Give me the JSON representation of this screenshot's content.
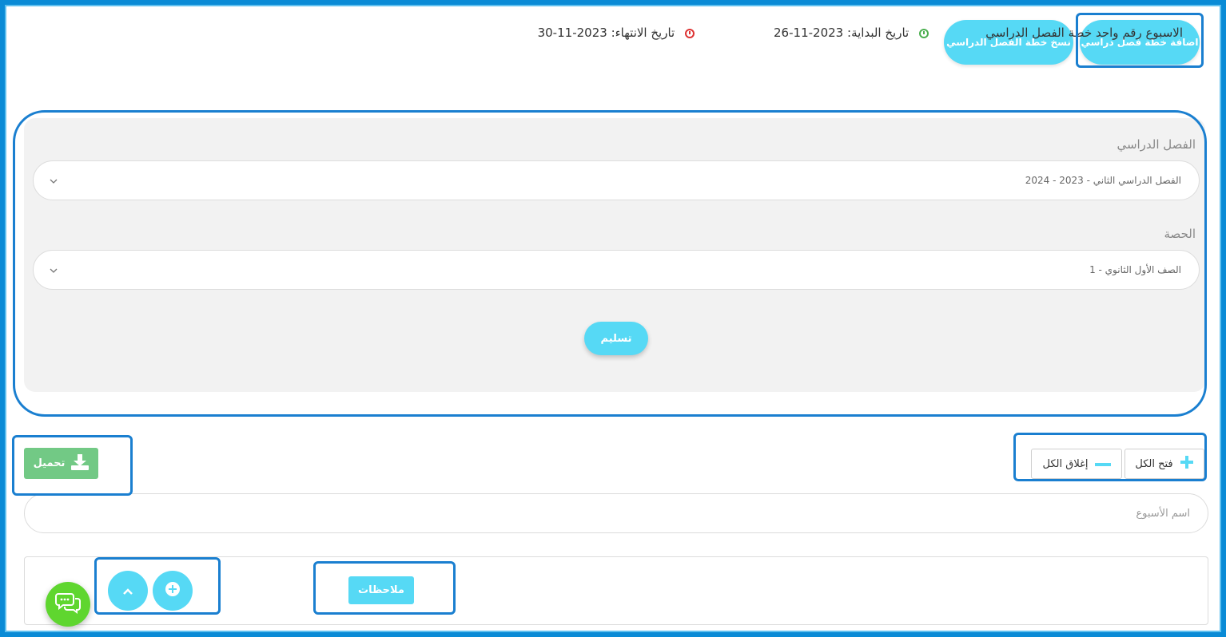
{
  "top_buttons": {
    "add_plan": "اضافة خطة فصل دراسي",
    "copy_plan": "نسخ خطة الفصل الدراسي"
  },
  "form": {
    "semester_label": "الفصل الدراسي",
    "semester_value": "الفصل الدراسي الثاني - 2023 - 2024",
    "class_label": "الحصة",
    "class_value": "الصف الأول الثانوي - 1",
    "submit_label": "تسليم"
  },
  "toolbar": {
    "open_all": "فتح الكل",
    "close_all": "إغلاق الكل",
    "download": "تحميل"
  },
  "search": {
    "placeholder": "اسم الأسبوع"
  },
  "week": {
    "name": "الاسبوع رقم واحد خطة الفصل الدراسي",
    "start_label": "تاريخ البداية:",
    "start_date": "2023-11-26",
    "end_label": "تاريخ الانتهاء:",
    "end_date": "2023-11-30",
    "notes_label": "ملاحظات"
  },
  "colors": {
    "accent": "#56d9f5",
    "download_green": "#72c985",
    "chat_green": "#5fd62f",
    "highlight_blue": "#1a7fd0"
  }
}
